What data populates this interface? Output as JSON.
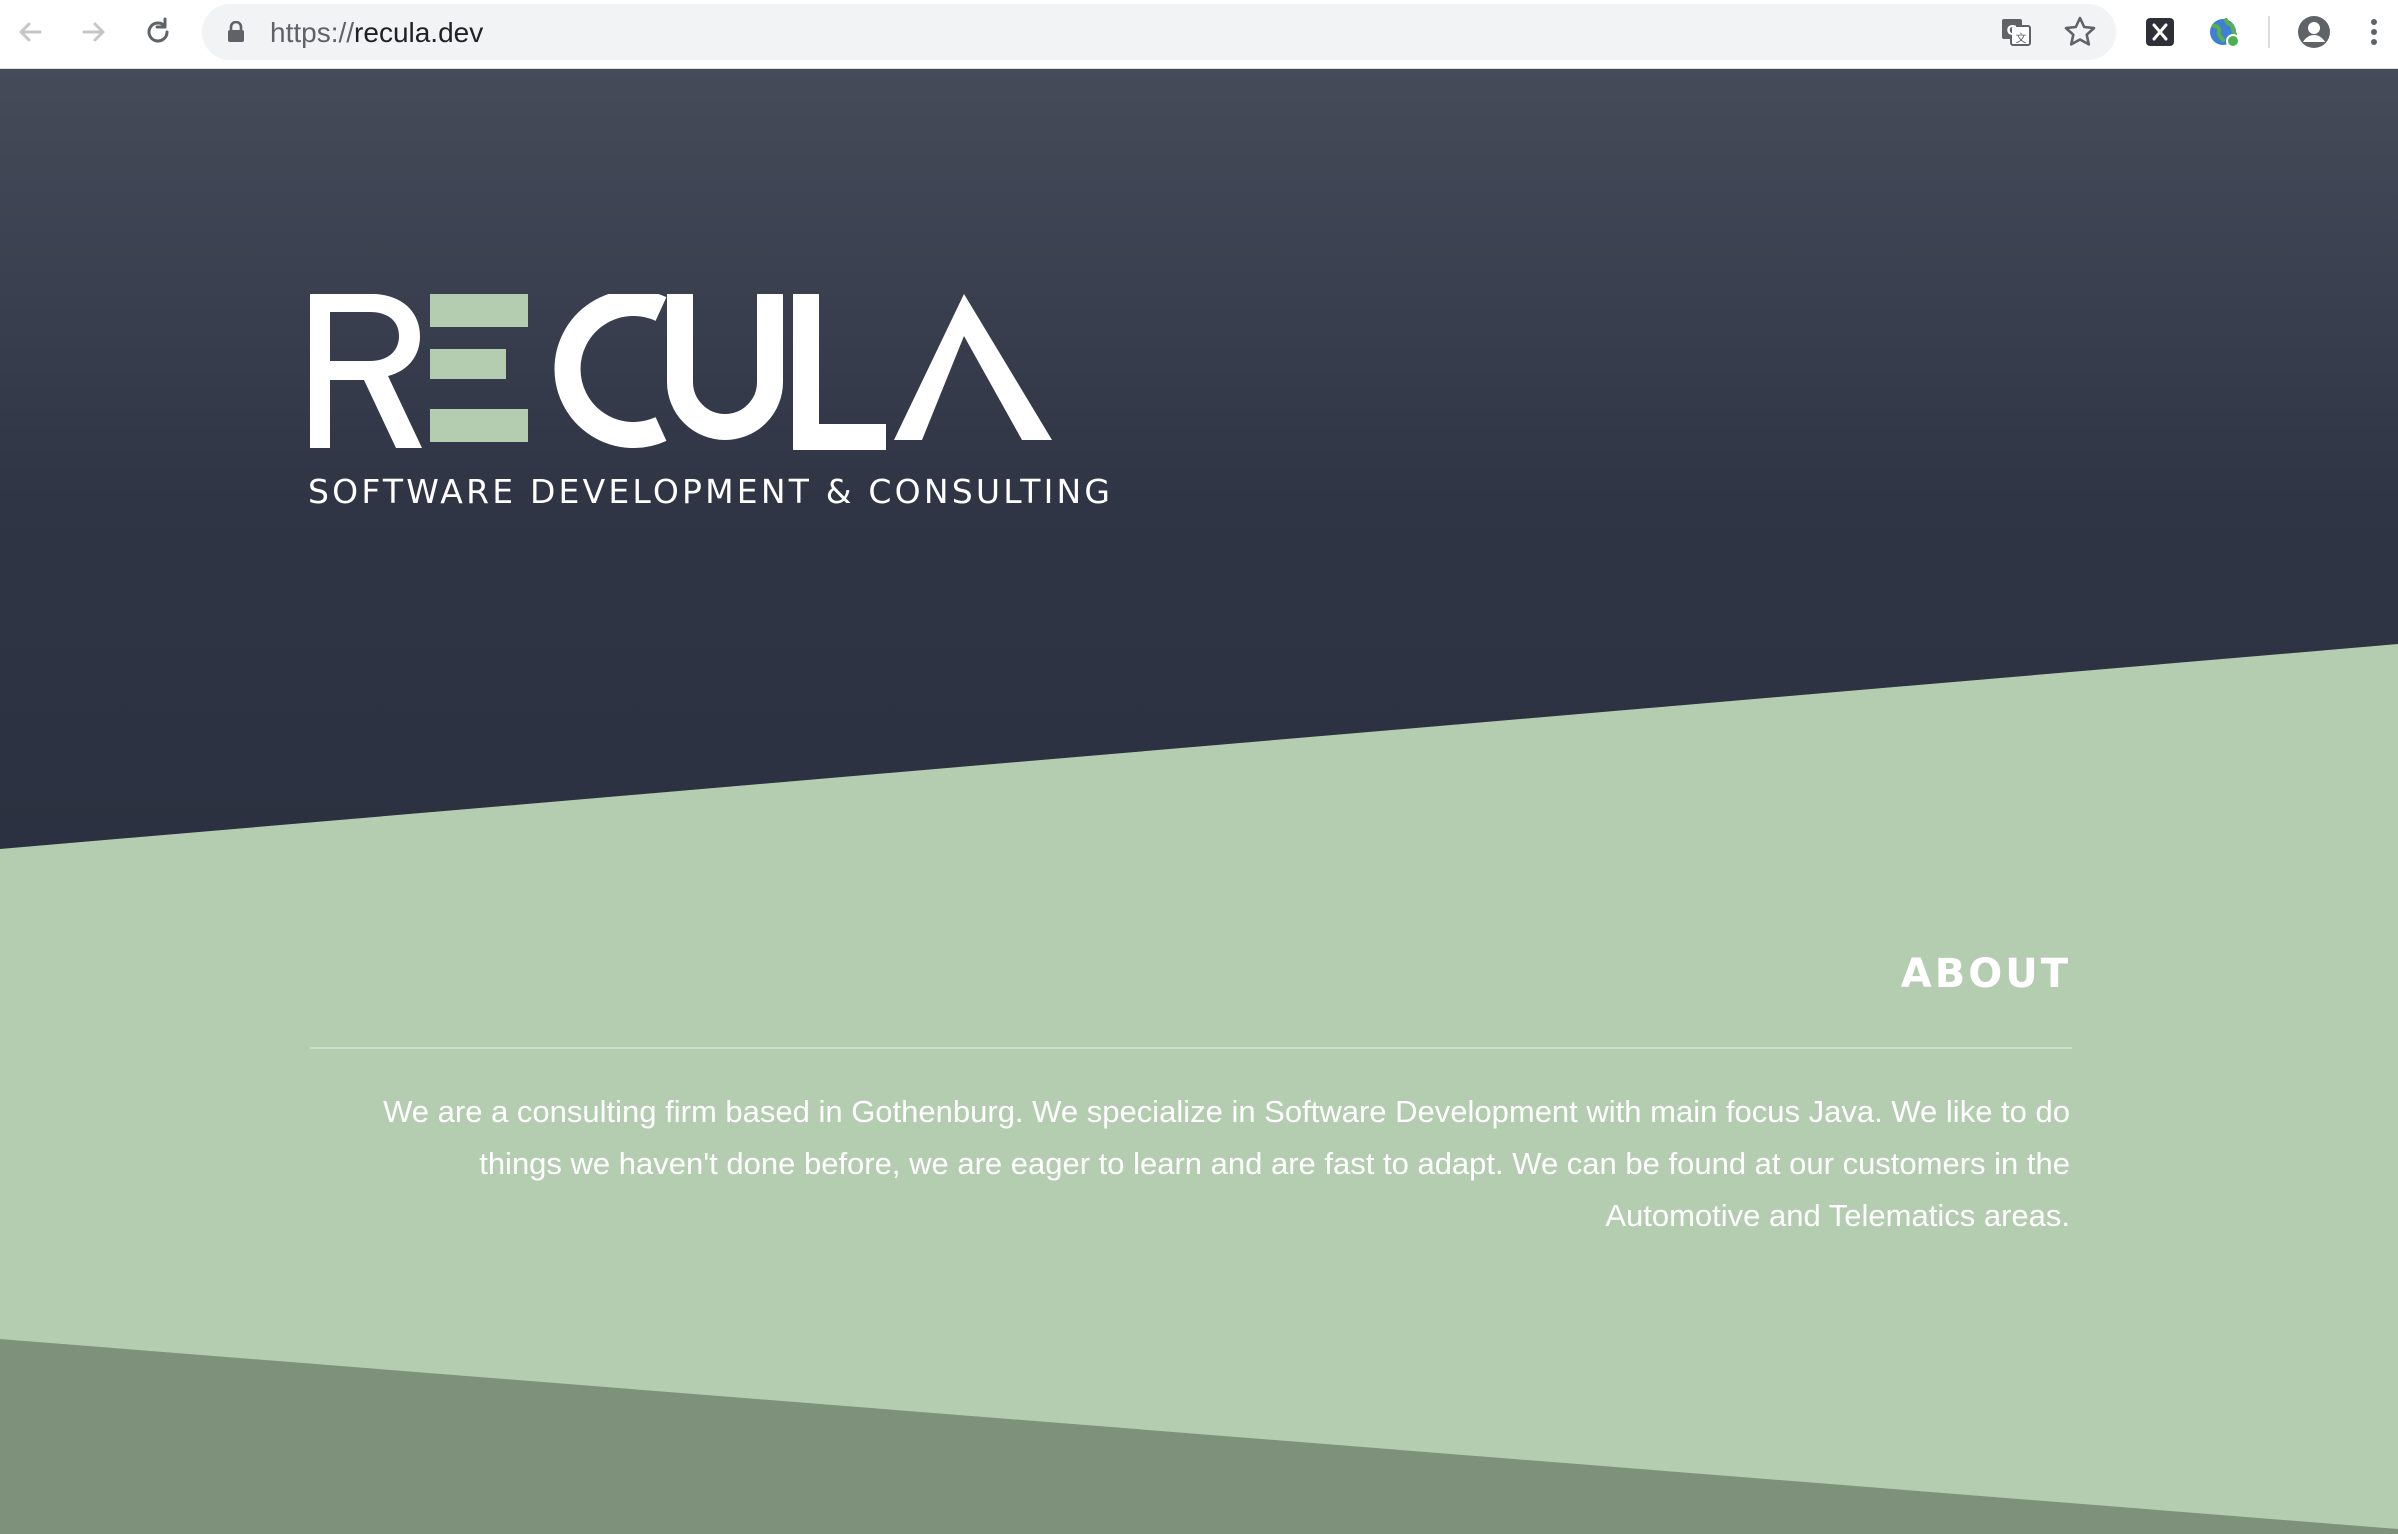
{
  "browser": {
    "url_scheme": "https://",
    "url_host": "recula.dev",
    "icons": [
      "back-arrow-icon",
      "forward-arrow-icon",
      "reload-icon",
      "lock-icon",
      "translate-icon",
      "star-icon",
      "extension-x-icon",
      "extension-globe-icon",
      "account-icon",
      "menu-dots-icon"
    ]
  },
  "hero": {
    "logo_text": "RECULA",
    "tagline": "SOFTWARE DEVELOPMENT & CONSULTING"
  },
  "about": {
    "heading": "ABOUT",
    "body": "We are a consulting firm based in Gothenburg. We specialize in Software Development with main focus Java. We like to do things we haven't done before, we are eager to learn and are fast to adapt. We can be found at our customers in the Automotive and Telematics areas."
  },
  "colors": {
    "hero_dark": "#2f3545",
    "accent_green": "#b4cdb1",
    "band_green": "#7e927b",
    "text": "#ffffff"
  }
}
